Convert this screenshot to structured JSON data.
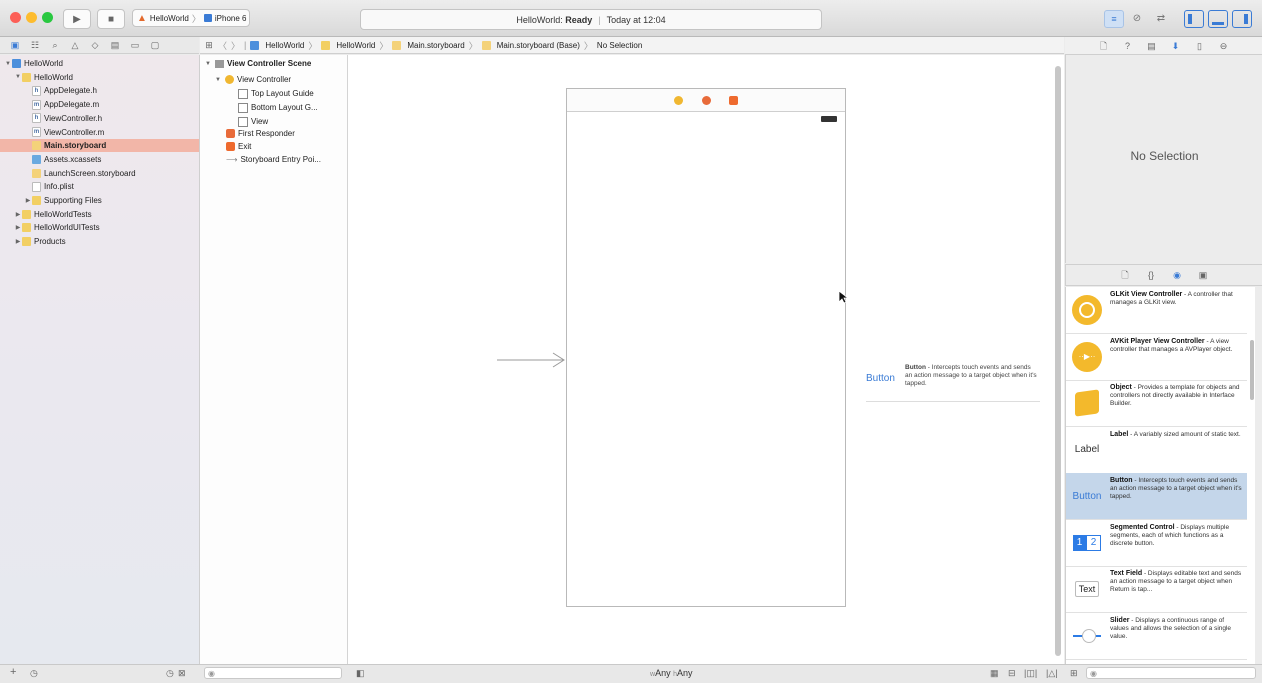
{
  "toolbar": {
    "scheme_project": "HelloWorld",
    "scheme_device": "iPhone 6",
    "status_app": "HelloWorld:",
    "status_state": "Ready",
    "status_time": "Today at 12:04"
  },
  "jumpbar": {
    "crumbs": [
      "HelloWorld",
      "HelloWorld",
      "Main.storyboard",
      "Main.storyboard (Base)",
      "No Selection"
    ]
  },
  "navigator": {
    "items": [
      {
        "label": "HelloWorld",
        "tri": "▼",
        "icon": "blueproj"
      },
      {
        "label": "HelloWorld",
        "tri": "▼",
        "icon": "folder"
      },
      {
        "label": "AppDelegate.h",
        "tri": "",
        "icon": "doc",
        "glyph": "h"
      },
      {
        "label": "AppDelegate.m",
        "tri": "",
        "icon": "doc",
        "glyph": "m"
      },
      {
        "label": "ViewController.h",
        "tri": "",
        "icon": "doc",
        "glyph": "h"
      },
      {
        "label": "ViewController.m",
        "tri": "",
        "icon": "doc",
        "glyph": "m"
      },
      {
        "label": "Main.storyboard",
        "tri": "",
        "icon": "sb",
        "selected": true
      },
      {
        "label": "Assets.xcassets",
        "tri": "",
        "icon": "assets"
      },
      {
        "label": "LaunchScreen.storyboard",
        "tri": "",
        "icon": "sb"
      },
      {
        "label": "Info.plist",
        "tri": "",
        "icon": "doc",
        "glyph": ""
      },
      {
        "label": "Supporting Files",
        "tri": "▶",
        "icon": "folder"
      },
      {
        "label": "HelloWorldTests",
        "tri": "▶",
        "icon": "folder"
      },
      {
        "label": "HelloWorldUITests",
        "tri": "▶",
        "icon": "folder"
      },
      {
        "label": "Products",
        "tri": "▶",
        "icon": "folder"
      }
    ]
  },
  "outline": {
    "scene": "View Controller Scene",
    "view_controller": "View Controller",
    "top_layout_guide": "Top Layout Guide",
    "bottom_layout_guide": "Bottom Layout G...",
    "view": "View",
    "first_responder": "First Responder",
    "exit": "Exit",
    "entry_point": "Storyboard Entry Poi..."
  },
  "drag_tooltip": {
    "button_label": "Button",
    "title": "Button",
    "description": " - Intercepts touch events and sends an action message to a target object when it's tapped."
  },
  "inspector": {
    "no_selection": "No Selection"
  },
  "library": {
    "items": [
      {
        "title": "GLKit View Controller",
        "desc": " - A controller that manages a GLKit view.",
        "icon": "glkit"
      },
      {
        "title": "AVKit Player View Controller",
        "desc": " - A view controller that manages a AVPlayer object.",
        "icon": "avkit"
      },
      {
        "title": "Object",
        "desc": " - Provides a template for objects and controllers not directly available in Interface Builder.",
        "icon": "object"
      },
      {
        "title": "Label",
        "desc": " - A variably sized amount of static text.",
        "icon": "label",
        "icon_text": "Label"
      },
      {
        "title": "Button",
        "desc": " - Intercepts touch events and sends an action message to a target object when it's tapped.",
        "icon": "button",
        "icon_text": "Button",
        "selected": true
      },
      {
        "title": "Segmented Control",
        "desc": " - Displays multiple segments, each of which functions as a discrete button.",
        "icon": "segmented",
        "seg1": "1",
        "seg2": "2"
      },
      {
        "title": "Text Field",
        "desc": " - Displays editable text and sends an action message to a target object when Return is tap...",
        "icon": "textfield",
        "icon_text": "Text"
      },
      {
        "title": "Slider",
        "desc": " - Displays a continuous range of values and allows the selection of a single value.",
        "icon": "slider"
      }
    ]
  },
  "bottombar": {
    "size_w_prefix": "w",
    "size_w": "Any",
    "size_h_prefix": "h",
    "size_h": "Any"
  },
  "colors": {
    "selection_row": "#f2b6a8",
    "library_selection": "#c4d6ea",
    "accent_blue": "#3a7bd5",
    "view_controller_yellow": "#f0b731"
  }
}
